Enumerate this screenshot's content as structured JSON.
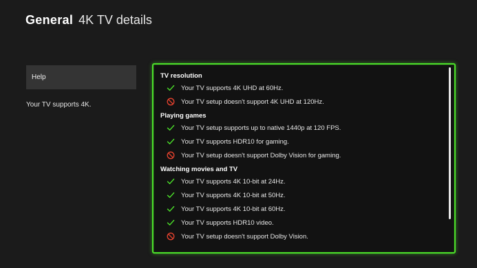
{
  "header": {
    "section": "General",
    "page_title": "4K TV details"
  },
  "sidebar": {
    "help_label": "Help",
    "note": "Your TV supports 4K."
  },
  "colors": {
    "accent_green": "#4ce12a",
    "check_green": "#4ce12a",
    "error_red": "#e8432f"
  },
  "groups": [
    {
      "title": "TV resolution",
      "items": [
        {
          "status": "ok",
          "icon": "check-icon",
          "text": "Your TV supports 4K UHD at 60Hz."
        },
        {
          "status": "no",
          "icon": "prohibited-icon",
          "text": "Your TV setup doesn't support 4K UHD at 120Hz."
        }
      ]
    },
    {
      "title": "Playing games",
      "items": [
        {
          "status": "ok",
          "icon": "check-icon",
          "text": "Your TV setup supports up to native 1440p at 120 FPS."
        },
        {
          "status": "ok",
          "icon": "check-icon",
          "text": "Your TV supports HDR10 for gaming."
        },
        {
          "status": "no",
          "icon": "prohibited-icon",
          "text": "Your TV setup doesn't support Dolby Vision for gaming."
        }
      ]
    },
    {
      "title": "Watching movies and TV",
      "items": [
        {
          "status": "ok",
          "icon": "check-icon",
          "text": "Your TV supports 4K 10-bit at 24Hz."
        },
        {
          "status": "ok",
          "icon": "check-icon",
          "text": "Your TV supports 4K 10-bit at 50Hz."
        },
        {
          "status": "ok",
          "icon": "check-icon",
          "text": "Your TV supports 4K 10-bit at 60Hz."
        },
        {
          "status": "ok",
          "icon": "check-icon",
          "text": "Your TV supports HDR10 video."
        },
        {
          "status": "no",
          "icon": "prohibited-icon",
          "text": "Your TV setup doesn't support Dolby Vision."
        }
      ]
    }
  ]
}
